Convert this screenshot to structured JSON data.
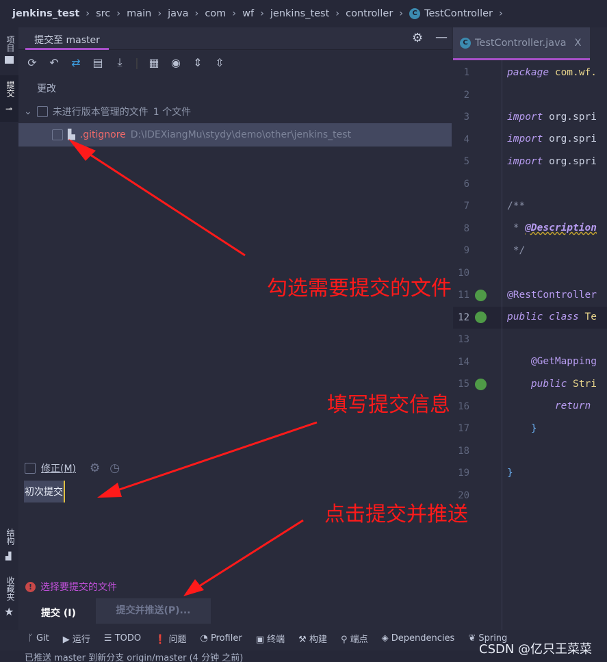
{
  "breadcrumb": [
    "jenkins_test",
    "src",
    "main",
    "java",
    "com",
    "wf",
    "jenkins_test",
    "controller",
    "TestController"
  ],
  "left_strip": {
    "project": "项目",
    "commit": "提交",
    "structure": "结构",
    "favorites": "收藏夹"
  },
  "commit_panel": {
    "tab": "提交至 master",
    "section": "更改",
    "group_label": "未进行版本管理的文件",
    "group_count": "1 个文件",
    "file_name": ".gitignore",
    "file_path": "D:\\IDEXiangMu\\stydy\\demo\\other\\jenkins_test",
    "amend_label": "修正(M)",
    "message": "初次提交",
    "warning": "选择要提交的文件",
    "commit_button": "提交 (I)",
    "commit_push_button": "提交并推送(P)..."
  },
  "editor": {
    "tab": "TestController.java",
    "close": "X",
    "line_numbers": [
      "1",
      "2",
      "3",
      "4",
      "5",
      "6",
      "7",
      "8",
      "9",
      "10",
      "11",
      "12",
      "13",
      "14",
      "15",
      "16",
      "17",
      "18",
      "19",
      "20"
    ]
  },
  "bottom_tools": [
    "Git",
    "运行",
    "TODO",
    "问题",
    "Profiler",
    "终端",
    "构建",
    "端点",
    "Dependencies",
    "Spring"
  ],
  "status": "已推送 master 到新分支 origin/master (4 分钟 之前)",
  "annotations": {
    "a1": "勾选需要提交的文件",
    "a2": "填写提交信息",
    "a3": "点击提交并推送"
  },
  "watermark": "CSDN @亿只王菜菜",
  "colors": {
    "accent": "#a74fc8",
    "annotation": "#ff1a1a",
    "warning": "#c050d8"
  }
}
